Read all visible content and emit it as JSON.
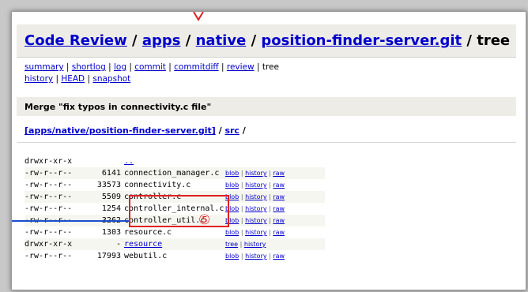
{
  "title": {
    "crumbs": [
      "Code Review",
      "apps",
      "native",
      "position-finder-server.git"
    ],
    "separator": " / ",
    "tail": "tree"
  },
  "nav": {
    "summary": "summary",
    "shortlog": "shortlog",
    "log": "log",
    "commit": "commit",
    "commitdiff": "commitdiff",
    "review": "review",
    "tree": "tree",
    "history": "history",
    "head": "HEAD",
    "snapshot": "snapshot"
  },
  "commit_message": "Merge \"fix typos in connectivity.c file\"",
  "path": {
    "repo": "[apps/native/position-finder-server.git]",
    "src": "src",
    "separator": " / "
  },
  "tree": {
    "rows": [
      {
        "mode": "drwxr-xr-x",
        "size": "",
        "name": "..",
        "type": "parent",
        "links": []
      },
      {
        "mode": "-rw-r--r--",
        "size": "6141",
        "name": "connection_manager.c",
        "type": "file",
        "links": [
          "blob",
          "history",
          "raw"
        ]
      },
      {
        "mode": "-rw-r--r--",
        "size": "33573",
        "name": "connectivity.c",
        "type": "file",
        "links": [
          "blob",
          "history",
          "raw"
        ]
      },
      {
        "mode": "-rw-r--r--",
        "size": "5509",
        "name": "controller.c",
        "type": "file",
        "links": [
          "blob",
          "history",
          "raw"
        ]
      },
      {
        "mode": "-rw-r--r--",
        "size": "1254",
        "name": "controller_internal.c",
        "type": "file",
        "links": [
          "blob",
          "history",
          "raw"
        ]
      },
      {
        "mode": "-rw-r--r--",
        "size": "3262",
        "name": "controller_util.c",
        "type": "file",
        "links": [
          "blob",
          "history",
          "raw"
        ]
      },
      {
        "mode": "-rw-r--r--",
        "size": "1303",
        "name": "resource.c",
        "type": "file",
        "links": [
          "blob",
          "history",
          "raw"
        ]
      },
      {
        "mode": "drwxr-xr-x",
        "size": "-",
        "name": "resource",
        "type": "dir",
        "links": [
          "tree",
          "history"
        ]
      },
      {
        "mode": "-rw-r--r--",
        "size": "17993",
        "name": "webutil.c",
        "type": "file",
        "links": [
          "blob",
          "history",
          "raw"
        ]
      }
    ]
  },
  "annotation": {
    "marker": "⑤",
    "color": "#e02020",
    "line_color": "#1a4fd0"
  },
  "colors": {
    "link": "#0000cc",
    "header_bg": "#edece6"
  }
}
